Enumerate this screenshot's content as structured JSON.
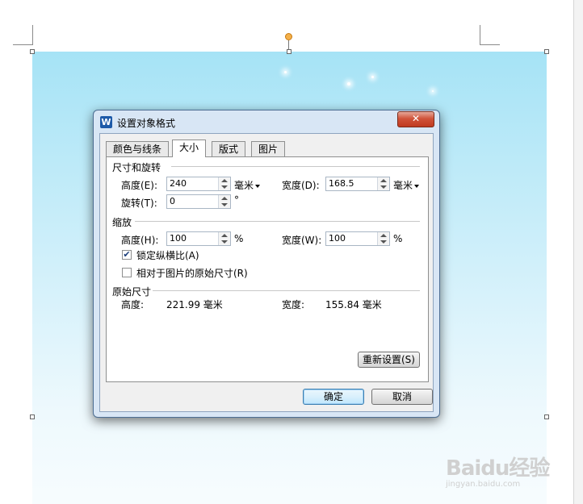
{
  "dialog": {
    "title": "设置对象格式",
    "app_icon_letter": "W",
    "close_label": "✕",
    "tabs": [
      {
        "label": "颜色与线条",
        "active": false
      },
      {
        "label": "大小",
        "active": true
      },
      {
        "label": "版式",
        "active": false
      },
      {
        "label": "图片",
        "active": false
      }
    ],
    "size_rotate": {
      "section_title": "尺寸和旋转",
      "height_label": "高度(E):",
      "height_value": "240",
      "height_unit": "毫米",
      "width_label": "宽度(D):",
      "width_value": "168.5",
      "width_unit": "毫米",
      "rotation_label": "旋转(T):",
      "rotation_value": "0",
      "rotation_unit": "°"
    },
    "scale": {
      "section_title": "缩放",
      "height_label": "高度(H):",
      "height_value": "100",
      "height_unit": "%",
      "width_label": "宽度(W):",
      "width_value": "100",
      "width_unit": "%",
      "lock_aspect_label": "锁定纵横比(A)",
      "lock_aspect_checked": true,
      "relative_original_label": "相对于图片的原始尺寸(R)",
      "relative_original_checked": false
    },
    "original_size": {
      "section_title": "原始尺寸",
      "height_label": "高度:",
      "height_value": "221.99 毫米",
      "width_label": "宽度:",
      "width_value": "155.84 毫米"
    },
    "reset_label": "重新设置(S)",
    "ok_label": "确定",
    "cancel_label": "取消"
  },
  "watermark": {
    "logo": "Baidu经验",
    "url": "jingyan.baidu.com"
  },
  "colors": {
    "dialog_frame": "#d8e6f5",
    "image_top": "#a6e3f6",
    "close_button": "#c9452c",
    "checkbox_mark": "#1b3d7a"
  }
}
